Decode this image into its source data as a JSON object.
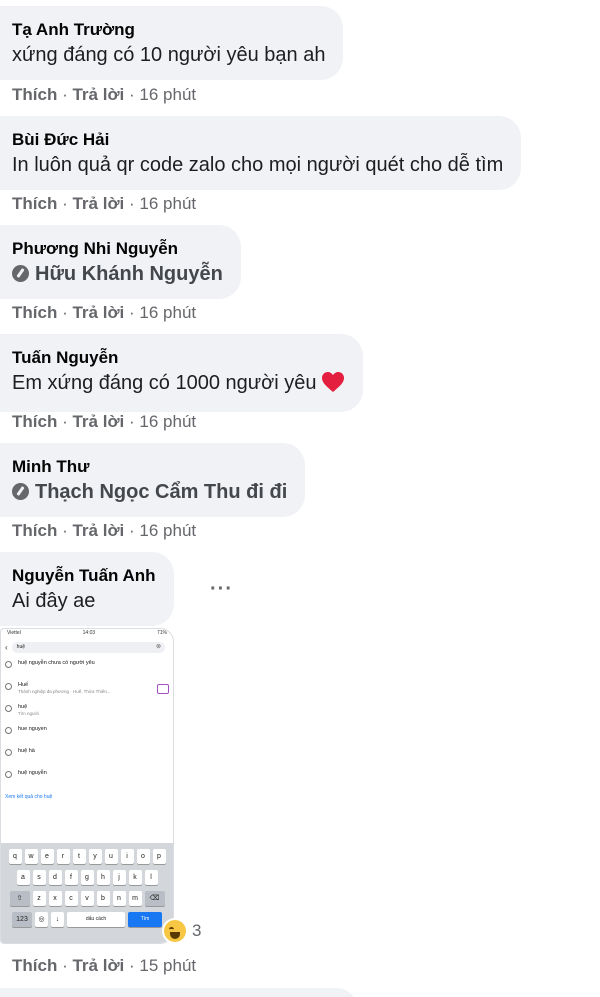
{
  "comments": [
    {
      "author": "Tạ Anh Trường",
      "text": "xứng đáng có 10 người yêu bạn ah",
      "like": "Thích",
      "reply": "Trả lời",
      "time": "16 phút"
    },
    {
      "author": "Bùi Đức Hải",
      "text": "In luôn quả qr code zalo cho mọi người quét cho dễ tìm",
      "like": "Thích",
      "reply": "Trả lời",
      "time": "16 phút"
    },
    {
      "author": "Phương Nhi Nguyễn",
      "mention": "Hữu Khánh Nguyễn",
      "like": "Thích",
      "reply": "Trả lời",
      "time": "16 phút"
    },
    {
      "author": "Tuấn Nguyễn",
      "text": "Em xứng đáng có 1000 người yêu",
      "emoji": "heart-icon",
      "like": "Thích",
      "reply": "Trả lời",
      "time": "16 phút"
    },
    {
      "author": "Minh Thư",
      "mention": "Thạch Ngọc Cẩm Thu",
      "text_after": "đi đi",
      "like": "Thích",
      "reply": "Trả lời",
      "time": "16 phút"
    },
    {
      "author": "Nguyễn Tuấn Anh",
      "text": "Ai đây ae",
      "like": "Thích",
      "reply": "Trả lời",
      "time": "15 phút",
      "reaction_count": "3",
      "reaction_icon": "haha-icon"
    }
  ],
  "separator": "·",
  "more_label": "···",
  "screenshot": {
    "status_left": "Viettel",
    "status_center": "14:03",
    "status_right": "71%",
    "query": "huệ",
    "results": [
      {
        "title": "huệ nguyễn chưa có người yêu",
        "sub": ""
      },
      {
        "title": "Huế",
        "sub": "Thành nghiệp đa phương · Huế, Thừa Thiên..."
      },
      {
        "title": "huệ",
        "sub": "Tìm người"
      },
      {
        "title": "hue nguyen",
        "sub": ""
      },
      {
        "title": "huệ hà",
        "sub": ""
      },
      {
        "title": "huệ nguyễn",
        "sub": ""
      }
    ],
    "see_all": "Xem kết quả cho huệ",
    "keyboard_row1": [
      "q",
      "w",
      "e",
      "r",
      "t",
      "y",
      "u",
      "i",
      "o",
      "p"
    ],
    "keyboard_row2": [
      "a",
      "s",
      "d",
      "f",
      "g",
      "h",
      "j",
      "k",
      "l"
    ],
    "keyboard_row3": [
      "z",
      "x",
      "c",
      "v",
      "b",
      "n",
      "m"
    ],
    "space_label": "dấu cách",
    "go_label": "Tìm"
  },
  "colors": {
    "bubble": "#f0f2f5",
    "meta": "#65676b",
    "heart": "#e41e3f"
  }
}
